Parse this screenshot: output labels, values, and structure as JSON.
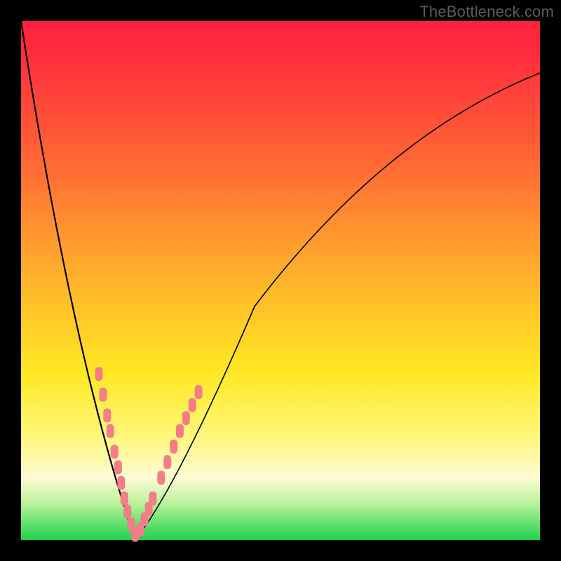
{
  "watermark": "TheBottleneck.com",
  "colors": {
    "frame": "#000000",
    "curve": "#000000",
    "marker": "#f47d87",
    "gradient_stops": [
      "#ff1f3f",
      "#ff3c3b",
      "#ff6a34",
      "#ff9a2e",
      "#ffc628",
      "#ffe824",
      "#fff77a",
      "#fffbd6",
      "#b9f29a",
      "#1fd24a"
    ]
  },
  "chart_data": {
    "type": "line",
    "title": "",
    "xlabel": "",
    "ylabel": "",
    "xlim": [
      0,
      100
    ],
    "ylim": [
      0,
      100
    ],
    "grid": false,
    "legend": false,
    "notes": "V-shaped bottleneck curve on red→green vertical gradient background. X and Y axes unlabeled; values are relative 0–100. Vertex of V at x≈22, y≈0. Left branch rises steeply to top-left corner; right branch rises with decreasing slope toward upper-right. Salmon-colored oval markers cluster along both branches near the vertex.",
    "series": [
      {
        "name": "left-branch",
        "x": [
          0,
          2,
          4,
          6,
          8,
          10,
          12,
          14,
          16,
          18,
          20,
          22
        ],
        "y": [
          100,
          91,
          82,
          73,
          64,
          55,
          46,
          37,
          28,
          19,
          9,
          0
        ]
      },
      {
        "name": "right-branch",
        "x": [
          22,
          25,
          28,
          32,
          36,
          40,
          45,
          50,
          56,
          63,
          71,
          80,
          90,
          100
        ],
        "y": [
          0,
          7,
          14,
          22,
          30,
          37,
          45,
          52,
          59,
          66,
          73,
          80,
          86,
          90
        ]
      }
    ],
    "markers": [
      {
        "branch": "left",
        "x": 15.0,
        "y": 32
      },
      {
        "branch": "left",
        "x": 15.8,
        "y": 28
      },
      {
        "branch": "left",
        "x": 16.6,
        "y": 24
      },
      {
        "branch": "left",
        "x": 17.2,
        "y": 21
      },
      {
        "branch": "left",
        "x": 18.0,
        "y": 17
      },
      {
        "branch": "left",
        "x": 18.7,
        "y": 14
      },
      {
        "branch": "left",
        "x": 19.3,
        "y": 11
      },
      {
        "branch": "left",
        "x": 19.9,
        "y": 8
      },
      {
        "branch": "left",
        "x": 20.5,
        "y": 5.5
      },
      {
        "branch": "left",
        "x": 21.2,
        "y": 3
      },
      {
        "branch": "left",
        "x": 22.0,
        "y": 1
      },
      {
        "branch": "right",
        "x": 23.0,
        "y": 2
      },
      {
        "branch": "right",
        "x": 23.8,
        "y": 4
      },
      {
        "branch": "right",
        "x": 24.6,
        "y": 6
      },
      {
        "branch": "right",
        "x": 25.4,
        "y": 8
      },
      {
        "branch": "right",
        "x": 27.0,
        "y": 12
      },
      {
        "branch": "right",
        "x": 28.2,
        "y": 15
      },
      {
        "branch": "right",
        "x": 29.4,
        "y": 18
      },
      {
        "branch": "right",
        "x": 30.6,
        "y": 21
      },
      {
        "branch": "right",
        "x": 31.8,
        "y": 23.5
      },
      {
        "branch": "right",
        "x": 33.0,
        "y": 26
      },
      {
        "branch": "right",
        "x": 34.2,
        "y": 28.5
      }
    ],
    "marker_style": {
      "shape": "rounded-rect",
      "rx": 5,
      "width": 11,
      "height": 20,
      "color": "#f47d87"
    }
  }
}
